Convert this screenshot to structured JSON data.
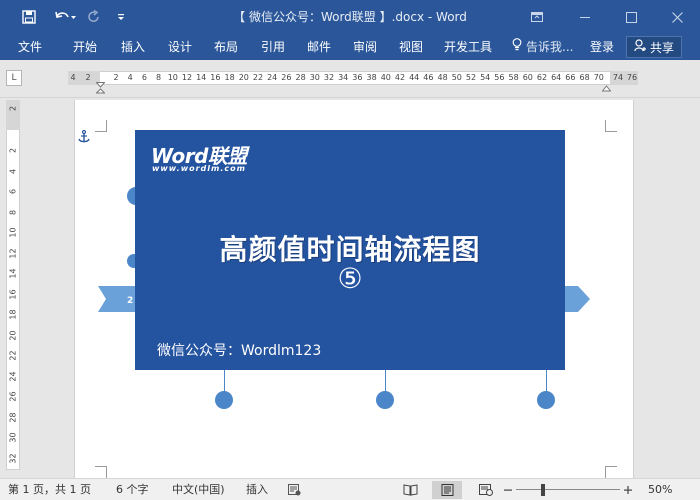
{
  "window": {
    "title": "【 微信公众号：Word联盟 】.docx - Word"
  },
  "ribbon": {
    "tabs": [
      "文件",
      "开始",
      "插入",
      "设计",
      "布局",
      "引用",
      "邮件",
      "审阅",
      "视图",
      "开发工具"
    ],
    "tell_me": "告诉我...",
    "login": "登录",
    "share": "共享"
  },
  "ruler": {
    "corner": "L",
    "horizontal_ticks": [
      "4",
      "2",
      "2",
      "4",
      "6",
      "8",
      "10",
      "12",
      "14",
      "16",
      "18",
      "20",
      "22",
      "24",
      "26",
      "28",
      "30",
      "32",
      "34",
      "36",
      "38",
      "40",
      "42",
      "44",
      "46",
      "48",
      "50",
      "52",
      "54",
      "56",
      "58",
      "60",
      "62",
      "64",
      "66",
      "68",
      "70",
      "74",
      "76"
    ],
    "vertical_ticks": [
      "2",
      "2",
      "4",
      "6",
      "8",
      "10",
      "12",
      "14",
      "16",
      "18",
      "20",
      "22",
      "24",
      "26",
      "28",
      "30",
      "32"
    ]
  },
  "document": {
    "cover": {
      "logo_text": "Word联盟",
      "logo_url": "www.wordlm.com",
      "title": "高颜值时间轴流程图",
      "number": "⑤",
      "subtitle": "微信公众号：Wordlm123"
    },
    "timeline_color": "#4a86c8",
    "cover_color": "#2453a0"
  },
  "statusbar": {
    "page": "第 1 页，共 1 页",
    "words": "6 个字",
    "language": "中文(中国)",
    "mode": "插入",
    "zoom": "50%"
  },
  "colors": {
    "brand": "#2b579a"
  }
}
